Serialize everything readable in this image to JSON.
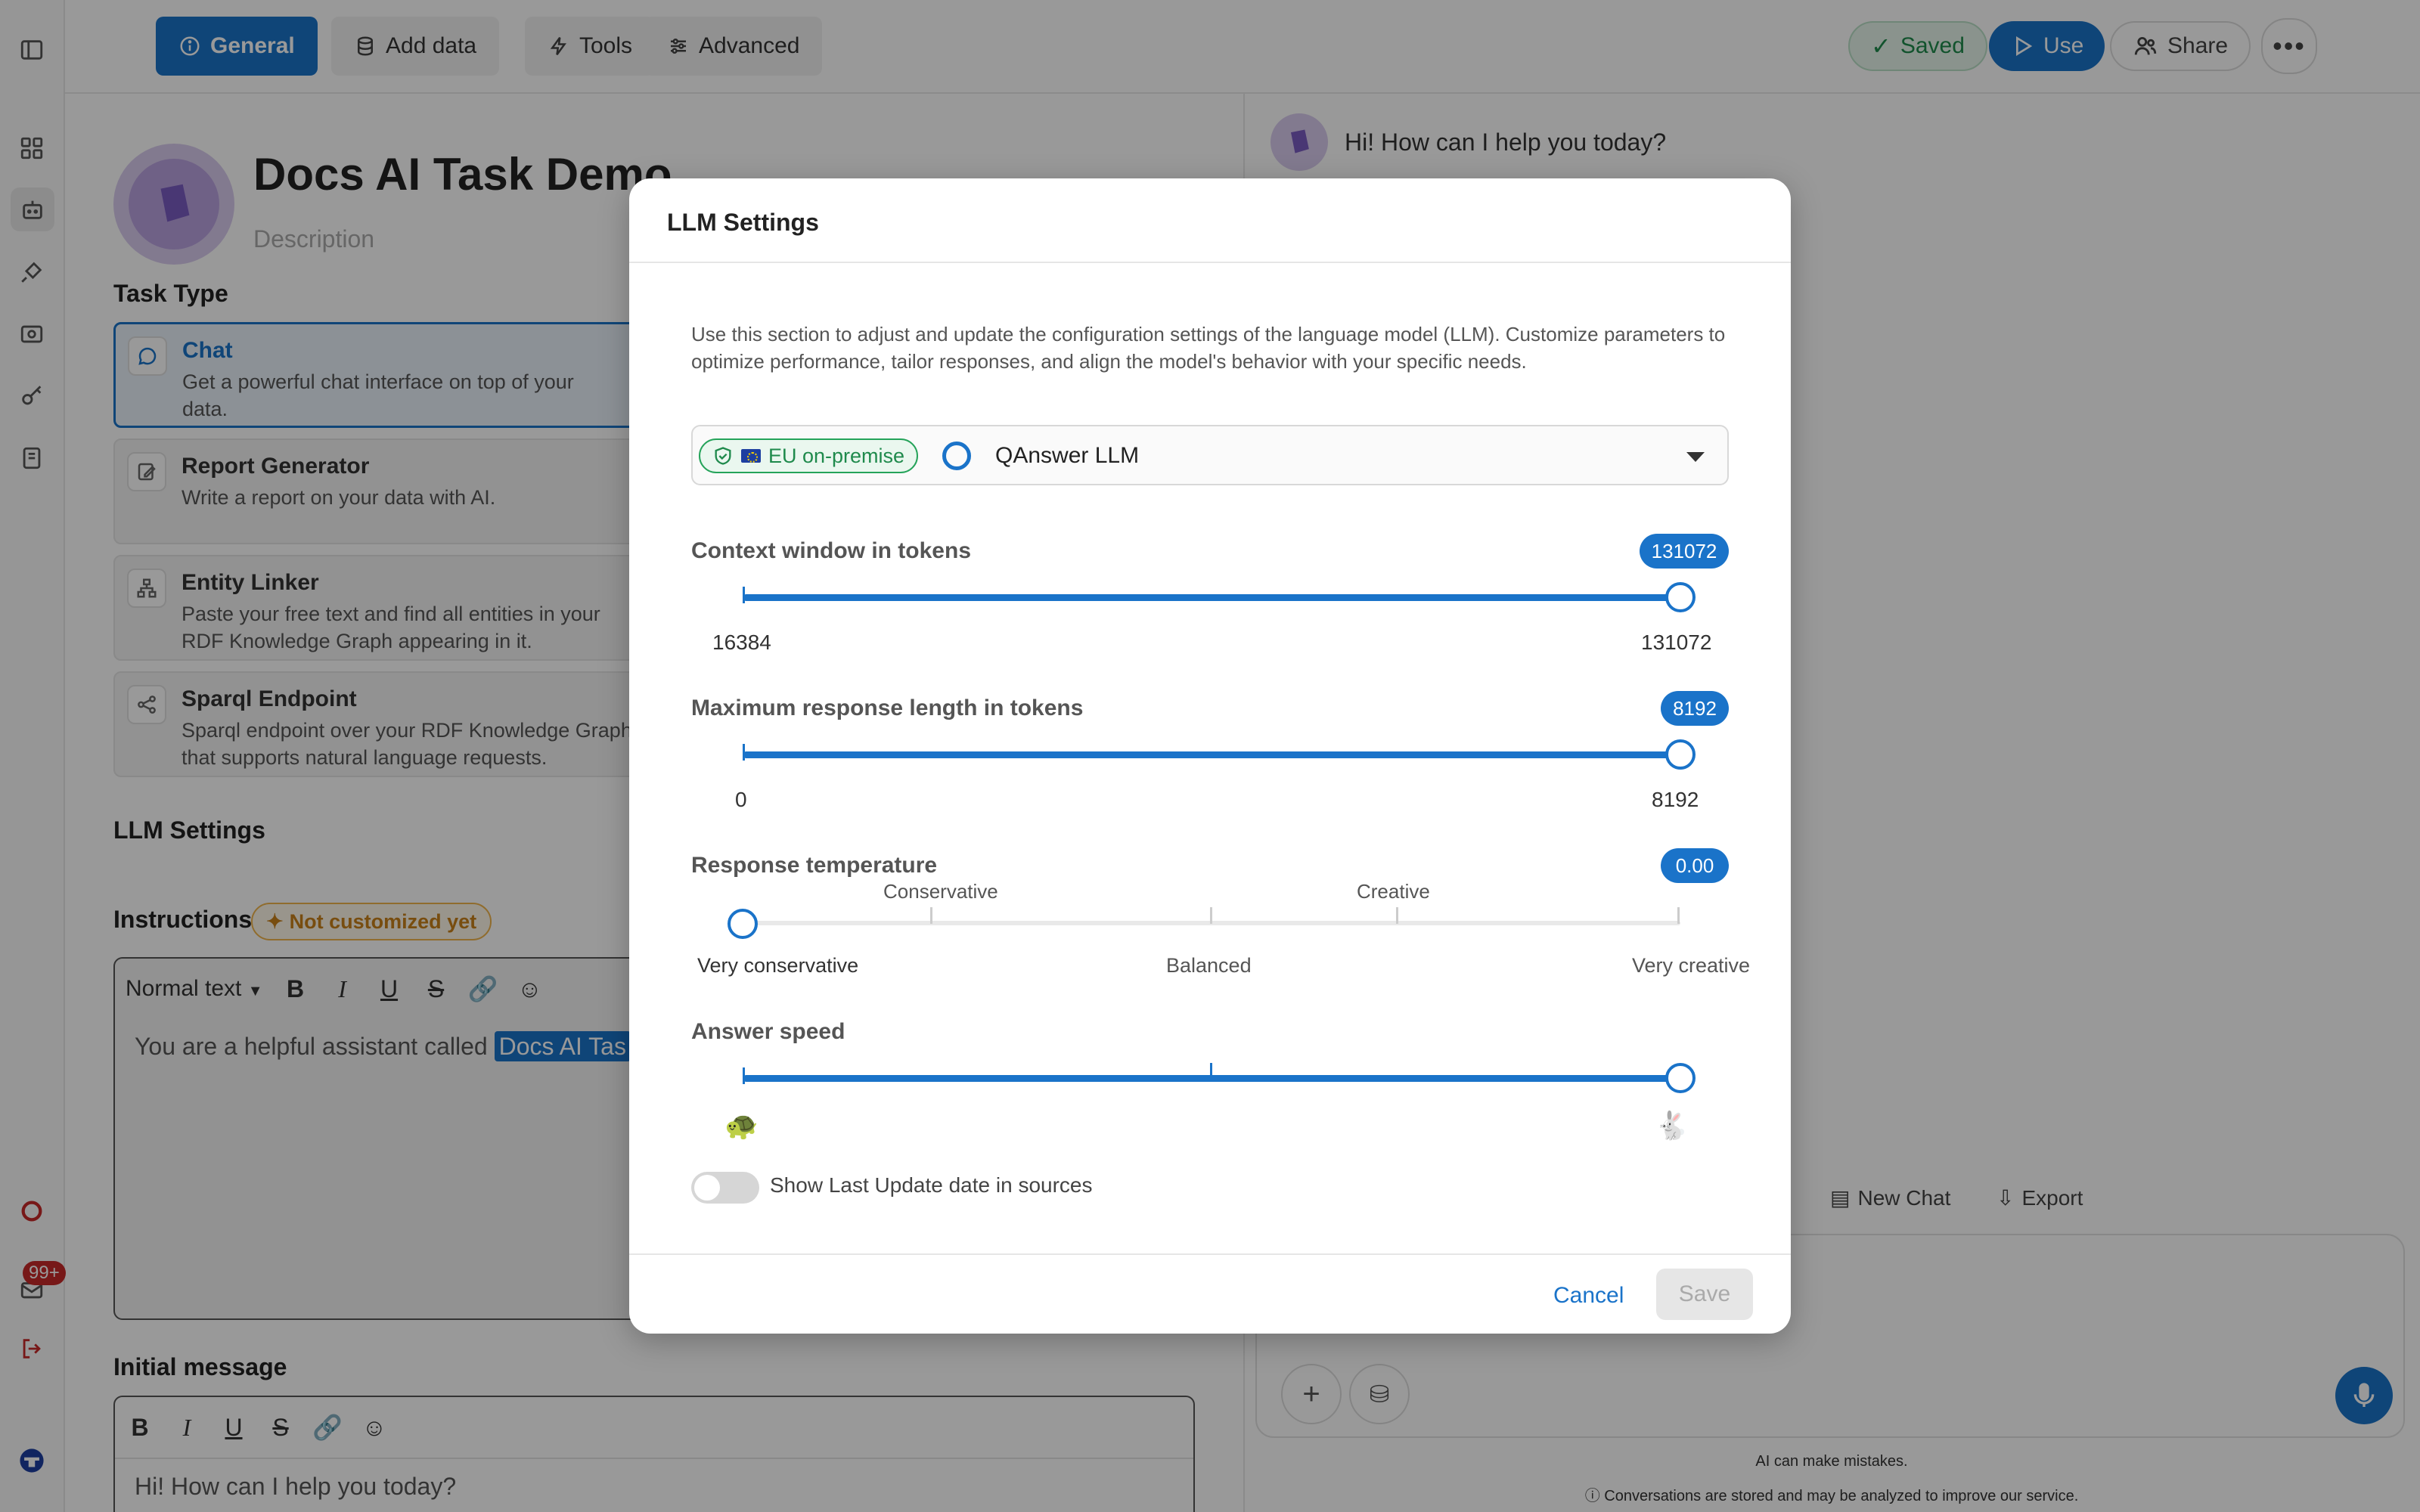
{
  "topbar": {
    "tabs": [
      {
        "label": "General",
        "icon": "info-icon",
        "active": true
      },
      {
        "label": "Add data",
        "icon": "database-icon"
      },
      {
        "label": "Tools",
        "icon": "bolt-icon"
      },
      {
        "label": "Advanced",
        "icon": "sliders-icon"
      }
    ],
    "saved_label": "Saved",
    "use_label": "Use",
    "share_label": "Share"
  },
  "rail": {
    "badge": "99+"
  },
  "editor": {
    "title": "Docs AI Task Demo",
    "description_placeholder": "Description",
    "task_type_heading": "Task Type",
    "task_types": [
      {
        "title": "Chat",
        "desc": "Get a powerful chat interface on top of your data.",
        "selected": true
      },
      {
        "title": "Report Generator",
        "desc": "Write a report on your data with AI."
      },
      {
        "title": "Entity Linker",
        "desc": "Paste your free text and find all entities in your RDF Knowledge Graph appearing in it."
      },
      {
        "title": "Sparql Endpoint",
        "desc": "Sparql endpoint over your RDF Knowledge Graph that supports natural language requests."
      }
    ],
    "llm_settings_heading": "LLM Settings",
    "instructions_heading": "Instructions",
    "not_customized": "Not customized yet",
    "text_style": "Normal text",
    "instructions_text": "You are a helpful assistant called",
    "instructions_highlight": "Docs AI Tas",
    "initial_message_heading": "Initial message",
    "initial_message_text": "Hi! How can I help you today?"
  },
  "chat": {
    "greeting": "Hi! How can I help you today?",
    "new_chat_label": "New Chat",
    "export_label": "Export",
    "disclaimer": "AI can make mistakes.",
    "privacy_note": "Conversations are stored and may be analyzed to improve our service."
  },
  "modal": {
    "title": "LLM Settings",
    "intro": "Use this section to adjust and update the configuration settings of the language model (LLM). Customize parameters to optimize performance, tailor responses, and align the model's behavior with your specific needs.",
    "hosting_badge": "EU on-premise",
    "model_name": "QAnswer LLM",
    "context_window": {
      "label": "Context window in tokens",
      "value": "131072",
      "min": "16384",
      "max": "131072"
    },
    "max_response": {
      "label": "Maximum response length in tokens",
      "value": "8192",
      "min": "0",
      "max": "8192"
    },
    "temperature": {
      "label": "Response temperature",
      "value": "0.00",
      "marks_top": [
        "Conservative",
        "Creative"
      ],
      "marks_bottom": [
        "Very conservative",
        "Balanced",
        "Very creative"
      ]
    },
    "answer_speed": {
      "label": "Answer speed",
      "value_fraction": 1.0
    },
    "toggle_label": "Show Last Update date in sources",
    "toggle_on": false,
    "cancel_label": "Cancel",
    "save_label": "Save"
  }
}
